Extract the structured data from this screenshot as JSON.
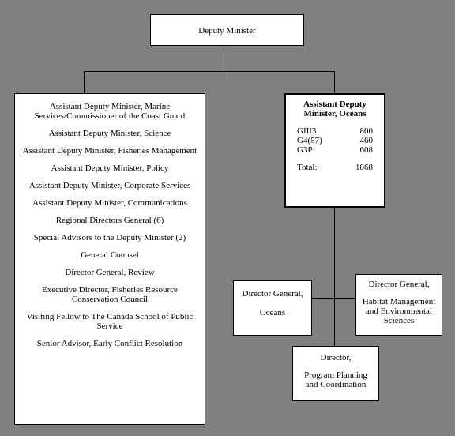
{
  "top": {
    "title": "Deputy Minister"
  },
  "left_list": [
    "Assistant Deputy Minister, Marine Services/Commissioner of the Coast Guard",
    "Assistant Deputy Minister, Science",
    "Assistant Deputy Minister, Fisheries Management",
    "Assistant Deputy Minister, Policy",
    "Assistant Deputy Minister, Corporate Services",
    "Assistant Deputy Minister, Communications",
    "Regional Directors General (6)",
    "Special Advisors to the Deputy Minister (2)",
    "General Counsel",
    "Director General, Review",
    "Executive Director, Fisheries Resource Conservation Council",
    "Visiting Fellow to The Canada School of Public Service",
    "Senior Advisor, Early Conflict Resolution"
  ],
  "adm": {
    "title": "Assistant Deputy Minister, Oceans",
    "rows": [
      {
        "code": "GIII3",
        "value": "800"
      },
      {
        "code": "G4(57)",
        "value": "460"
      },
      {
        "code": "G3P",
        "value": "608"
      }
    ],
    "total_label": "Total:",
    "total_value": "1868"
  },
  "dg_oceans": {
    "l1": "Director General,",
    "l2": "Oceans"
  },
  "dg_habitat": {
    "l1": "Director General,",
    "l2": "Habitat Management and Environmental Sciences"
  },
  "director": {
    "l1": "Director,",
    "l2": "Program Planning and Coordination"
  }
}
